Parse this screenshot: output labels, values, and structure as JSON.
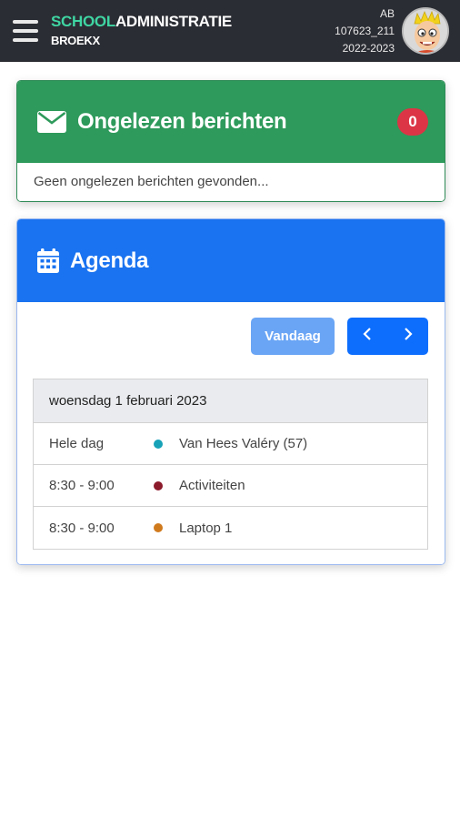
{
  "header": {
    "brand_part1": "SCHOOL",
    "brand_part2": "ADMINISTRATIE",
    "school": "BROEKX",
    "user_initials": "AB",
    "user_id": "107623_211",
    "school_year": "2022-2023",
    "accent_color": "#3fd6a3"
  },
  "messages": {
    "title": "Ongelezen berichten",
    "count": "0",
    "empty_text": "Geen ongelezen berichten gevonden...",
    "color": "#2e9a5b"
  },
  "agenda": {
    "title": "Agenda",
    "today_label": "Vandaag",
    "date_heading": "woensdag 1 februari 2023",
    "color": "#1a73f0",
    "events": [
      {
        "time": "Hele dag",
        "title": "Van Hees Valéry (57)",
        "color": "#17a2b8"
      },
      {
        "time": "8:30 - 9:00",
        "title": "Activiteiten",
        "color": "#8b1a2b"
      },
      {
        "time": "8:30 - 9:00",
        "title": "Laptop 1",
        "color": "#d07a1e"
      }
    ]
  }
}
